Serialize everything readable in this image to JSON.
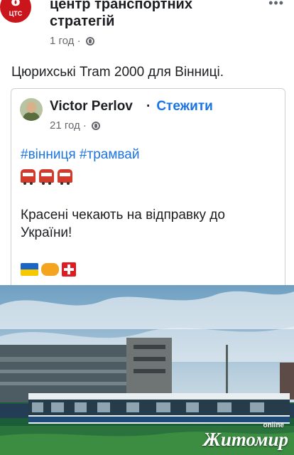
{
  "post": {
    "page_name": "центр транспортних стратегій",
    "page_avatar_text": "ЦТС",
    "time": "1 год ·",
    "text": "Цюрихські Tram 2000 для Вінниці."
  },
  "shared": {
    "author": "Victor Perlov",
    "follow_dot": "·",
    "follow": "Стежити",
    "time": "21 год ·",
    "hashtags": "#вінниця #трамвай",
    "body": "Красені чекають на відправку до України!"
  },
  "photo": {
    "watermark_online": "online",
    "watermark_city": "Житомир"
  },
  "colors": {
    "accent": "#1b74e4",
    "brand_red": "#c9151b"
  },
  "icons": [
    "more-icon",
    "globe-icon",
    "tram-emoji",
    "ukraine-flag",
    "handshake-emoji",
    "switzerland-flag"
  ]
}
